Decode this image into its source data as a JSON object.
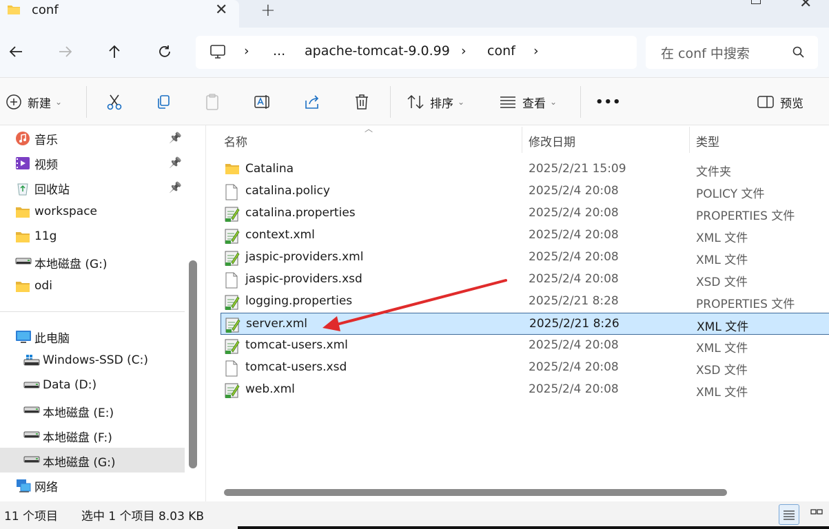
{
  "tab": {
    "title": "conf",
    "close": "✕",
    "new_tab": "+"
  },
  "nav": {
    "breadcrumb": [
      "...",
      "apache-tomcat-9.0.99",
      "conf"
    ],
    "search_placeholder": "在 conf 中搜索"
  },
  "toolbar": {
    "new_label": "新建",
    "sort_label": "排序",
    "view_label": "查看",
    "more_label": "•••",
    "preview_label": "预览"
  },
  "sidebar": {
    "quick_access": [
      {
        "label": "音乐",
        "icon": "music-icon",
        "pinned": true
      },
      {
        "label": "视频",
        "icon": "video-icon",
        "pinned": true
      },
      {
        "label": "回收站",
        "icon": "recycle-bin-icon",
        "pinned": true
      },
      {
        "label": "workspace",
        "icon": "folder-icon",
        "pinned": false
      },
      {
        "label": "11g",
        "icon": "folder-icon",
        "pinned": false
      },
      {
        "label": "本地磁盘 (G:)",
        "icon": "drive-icon",
        "pinned": false
      },
      {
        "label": "odi",
        "icon": "folder-icon",
        "pinned": false
      }
    ],
    "this_pc": {
      "label": "此电脑",
      "icon": "computer-icon"
    },
    "drives": [
      {
        "label": "Windows-SSD (C:)",
        "icon": "windows-drive-icon"
      },
      {
        "label": "Data (D:)",
        "icon": "drive-icon"
      },
      {
        "label": "本地磁盘 (E:)",
        "icon": "drive-icon"
      },
      {
        "label": "本地磁盘 (F:)",
        "icon": "drive-icon"
      },
      {
        "label": "本地磁盘 (G:)",
        "icon": "drive-icon"
      }
    ],
    "network": {
      "label": "网络",
      "icon": "network-icon"
    }
  },
  "filelist": {
    "columns": {
      "name": "名称",
      "modified": "修改日期",
      "type": "类型"
    },
    "files": [
      {
        "name": "Catalina",
        "modified": "2025/2/21 15:09",
        "type": "文件夹",
        "icon": "folder-icon"
      },
      {
        "name": "catalina.policy",
        "modified": "2025/2/4 20:08",
        "type": "POLICY 文件",
        "icon": "file-icon"
      },
      {
        "name": "catalina.properties",
        "modified": "2025/2/4 20:08",
        "type": "PROPERTIES 文件",
        "icon": "notepad-file-icon"
      },
      {
        "name": "context.xml",
        "modified": "2025/2/4 20:08",
        "type": "XML 文件",
        "icon": "notepad-file-icon"
      },
      {
        "name": "jaspic-providers.xml",
        "modified": "2025/2/4 20:08",
        "type": "XML 文件",
        "icon": "notepad-file-icon"
      },
      {
        "name": "jaspic-providers.xsd",
        "modified": "2025/2/4 20:08",
        "type": "XSD 文件",
        "icon": "file-icon"
      },
      {
        "name": "logging.properties",
        "modified": "2025/2/21 8:28",
        "type": "PROPERTIES 文件",
        "icon": "notepad-file-icon"
      },
      {
        "name": "server.xml",
        "modified": "2025/2/21 8:26",
        "type": "XML 文件",
        "icon": "notepad-file-icon",
        "selected": true
      },
      {
        "name": "tomcat-users.xml",
        "modified": "2025/2/4 20:08",
        "type": "XML 文件",
        "icon": "notepad-file-icon"
      },
      {
        "name": "tomcat-users.xsd",
        "modified": "2025/2/4 20:08",
        "type": "XSD 文件",
        "icon": "file-icon"
      },
      {
        "name": "web.xml",
        "modified": "2025/2/4 20:08",
        "type": "XML 文件",
        "icon": "notepad-file-icon"
      }
    ]
  },
  "status": {
    "item_count": "11 个项目",
    "selection": "选中 1 个项目  8.03 KB"
  },
  "colors": {
    "selection_bg": "#cce8ff",
    "selection_border": "#3d6a9a",
    "arrow": "#e02b2b"
  }
}
